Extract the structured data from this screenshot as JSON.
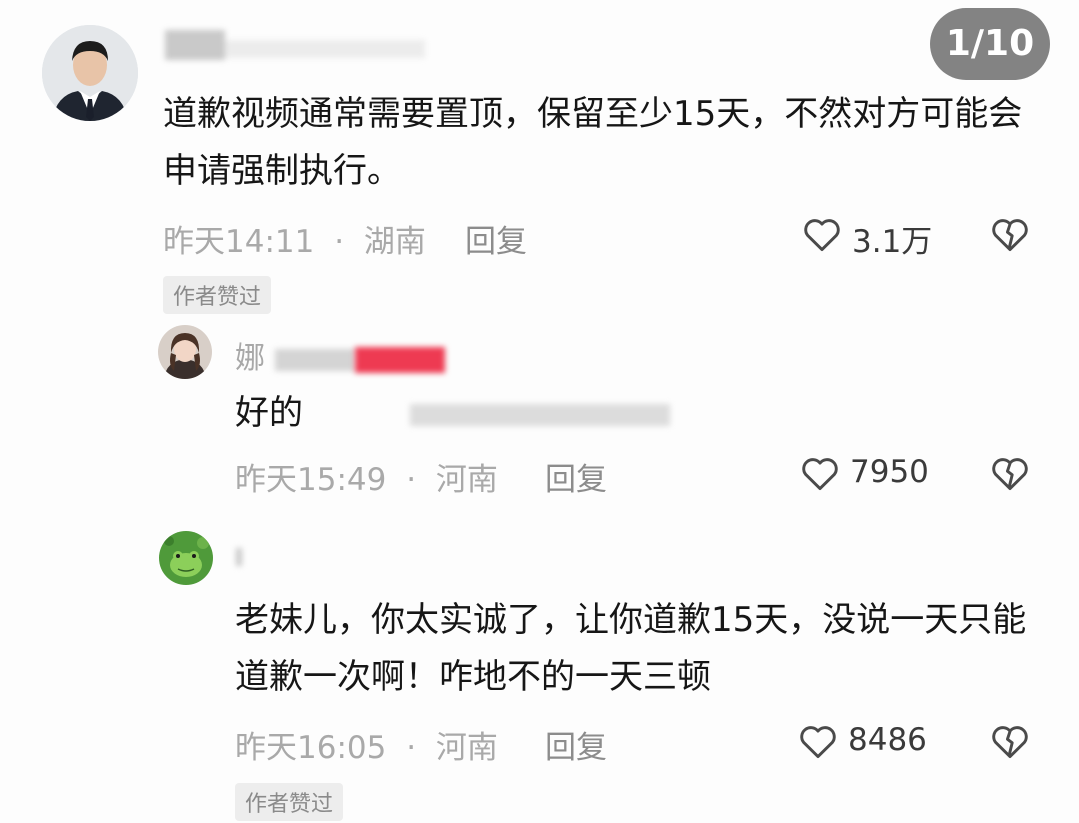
{
  "counter": "1/10",
  "comments": [
    {
      "text": "道歉视频通常需要置顶，保留至少15天，不然对方可能会申请强制执行。",
      "time": "昨天14:11",
      "sep": "·",
      "location": "湖南",
      "reply": "回复",
      "likes": "3.1万",
      "badge": "作者赞过"
    },
    {
      "username": "娜",
      "text": "好的",
      "time": "昨天15:49",
      "sep": "·",
      "location": "河南",
      "reply": "回复",
      "likes": "7950"
    },
    {
      "text": "老妹儿，你太实诚了，让你道歉15天，没说一天只能道歉一次啊！咋地不的一天三顿",
      "time": "昨天16:05",
      "sep": "·",
      "location": "河南",
      "reply": "回复",
      "likes": "8486",
      "badge": "作者赞过"
    }
  ],
  "icons": {
    "like": "heart-outline-icon",
    "dislike": "broken-heart-icon"
  },
  "colors": {
    "counter_bg": "#787878",
    "meta_gray": "#a9a9a9",
    "badge_bg": "#ededed"
  }
}
